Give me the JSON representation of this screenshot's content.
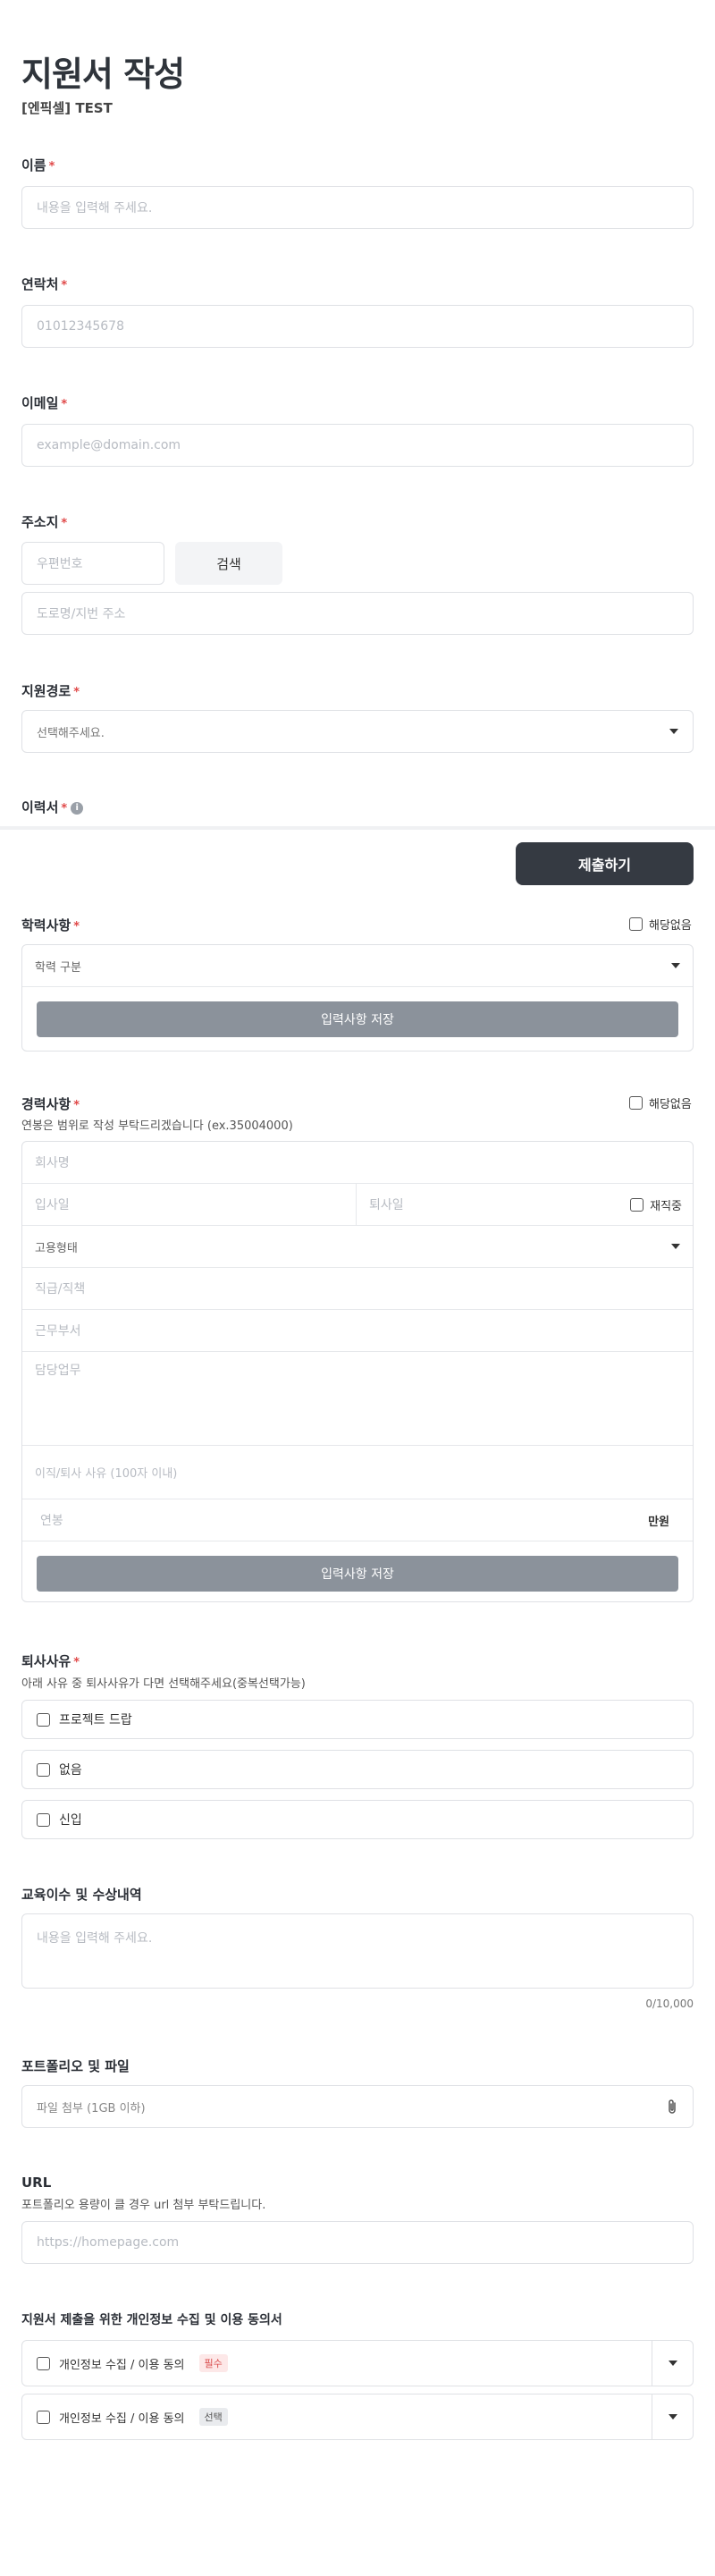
{
  "header": {
    "title": "지원서 작성",
    "subtitle": "[엔픽셀] TEST"
  },
  "required_mark": "*",
  "name": {
    "label": "이름",
    "placeholder": "내용을 입력해 주세요."
  },
  "phone": {
    "label": "연락처",
    "placeholder": "01012345678"
  },
  "email": {
    "label": "이메일",
    "placeholder": "example@domain.com"
  },
  "address": {
    "label": "주소지",
    "postcode_placeholder": "우편번호",
    "search_label": "검색",
    "street_placeholder": "도로명/지번 주소"
  },
  "channel": {
    "label": "지원경로",
    "placeholder": "선택해주세요."
  },
  "resume": {
    "label": "이력서",
    "info_icon": "i"
  },
  "submit_label": "제출하기",
  "education": {
    "label": "학력사항",
    "none_label": "해당없음",
    "type_placeholder": "학력 구분",
    "save_label": "입력사항 저장"
  },
  "career": {
    "label": "경력사항",
    "none_label": "해당없음",
    "note": "연봉은 범위로 작성 부탁드리겠습니다 (ex.35004000)",
    "company_placeholder": "회사명",
    "start_placeholder": "입사일",
    "end_placeholder": "퇴사일",
    "current_label": "재직중",
    "employment_placeholder": "고용형태",
    "position_placeholder": "직급/직책",
    "dept_placeholder": "근무부서",
    "duties_placeholder": "담당업무",
    "reason_placeholder": "이직/퇴사 사유 (100자 이내)",
    "salary_placeholder": "연봉",
    "salary_unit": "만원",
    "save_label": "입력사항 저장"
  },
  "leave_reason": {
    "label": "퇴사사유",
    "note": "아래 사유 중 퇴사사유가 다면 선택해주세요(중복선택가능)",
    "options": [
      "프로젝트 드랍",
      "없음",
      "신입"
    ]
  },
  "training": {
    "label": "교육이수 및 수상내역",
    "placeholder": "내용을 입력해 주세요.",
    "counter": "0/10,000"
  },
  "portfolio": {
    "label": "포트폴리오 및 파일",
    "placeholder": "파일 첨부 (1GB 이하)"
  },
  "url": {
    "label": "URL",
    "note": "포트폴리오 용량이 클 경우 url 첨부 부탁드립니다.",
    "placeholder": "https://homepage.com"
  },
  "consent": {
    "label": "지원서 제출을 위한 개인정보 수집 및 이용 동의서",
    "items": [
      {
        "text": "개인정보 수집 / 이용 동의",
        "badge": "필수"
      },
      {
        "text": "개인정보 수집 / 이용 동의",
        "badge": "선택"
      }
    ]
  }
}
